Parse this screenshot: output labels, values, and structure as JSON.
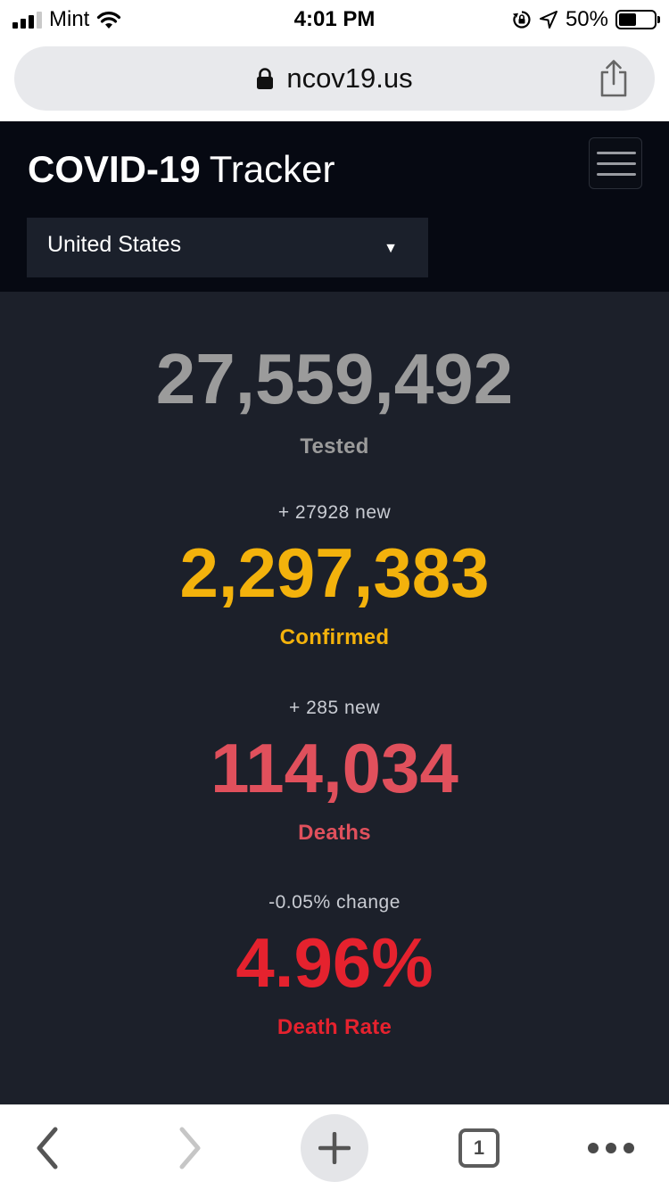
{
  "status_bar": {
    "carrier": "Mint",
    "time": "4:01 PM",
    "battery": "50%",
    "battery_level": 0.5,
    "icons": [
      "signal-icon",
      "wifi-icon",
      "rotation-lock-icon",
      "location-icon",
      "battery-icon"
    ]
  },
  "browser": {
    "url": "ncov19.us",
    "icons": [
      "lock-icon",
      "share-icon"
    ],
    "toolbar_icons": [
      "back-icon",
      "forward-icon",
      "new-tab-icon",
      "tabs-icon",
      "more-icon"
    ],
    "tab_count": "1"
  },
  "header": {
    "brand_bold": "COVID-19",
    "brand_light": "Tracker",
    "country": "United States",
    "caret": "▼"
  },
  "stats": {
    "tested": {
      "value": "27,559,492",
      "label": "Tested",
      "color": "#9b9b9b"
    },
    "confirmed": {
      "change": "+ 27928 new",
      "value": "2,297,383",
      "label": "Confirmed",
      "color": "#f3b20c"
    },
    "deaths": {
      "change": "+ 285 new",
      "value": "114,034",
      "label": "Deaths",
      "color": "#e0505c"
    },
    "death_rate": {
      "change": "-0.05% change",
      "value": "4.96%",
      "label": "Death Rate",
      "color": "#e5222e"
    }
  },
  "colors": {
    "header_bg": "#060912",
    "page_bg": "#1c202a",
    "select_bg": "#1b202b"
  }
}
